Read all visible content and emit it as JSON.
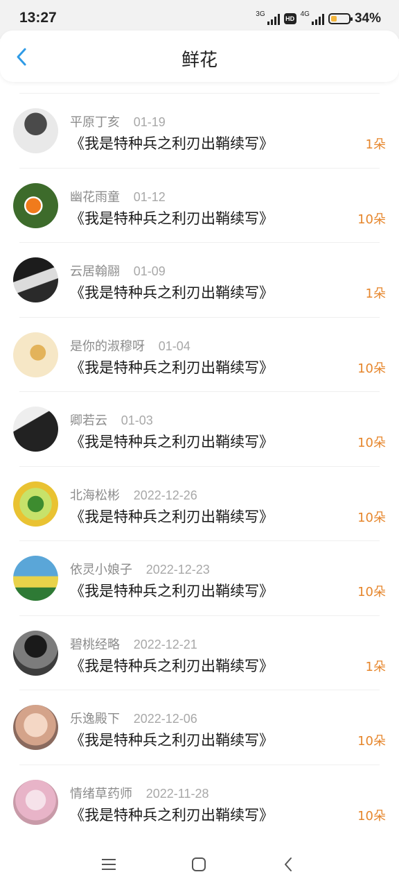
{
  "status_bar": {
    "time": "13:27",
    "net1": "3G",
    "hd": "HD",
    "net2": "4G",
    "battery_percent": "34%",
    "battery_level": 0.34
  },
  "header": {
    "title": "鲜花",
    "back_icon": "chevron-left-icon",
    "accent_color": "#2f9be6"
  },
  "colors": {
    "count": "#e6862c",
    "name": "#8c8c8c"
  },
  "items": [
    {
      "name": "平原丁亥",
      "date": "01-19",
      "book": "《我是特种兵之利刃出鞘续写》",
      "count": "1朵"
    },
    {
      "name": "幽花雨童",
      "date": "01-12",
      "book": "《我是特种兵之利刃出鞘续写》",
      "count": "10朵"
    },
    {
      "name": "云居翰翮",
      "date": "01-09",
      "book": "《我是特种兵之利刃出鞘续写》",
      "count": "1朵"
    },
    {
      "name": "是你的淑穆呀",
      "date": "01-04",
      "book": "《我是特种兵之利刃出鞘续写》",
      "count": "10朵"
    },
    {
      "name": "卿若云",
      "date": "01-03",
      "book": "《我是特种兵之利刃出鞘续写》",
      "count": "10朵"
    },
    {
      "name": "北海松彬",
      "date": "2022-12-26",
      "book": "《我是特种兵之利刃出鞘续写》",
      "count": "10朵"
    },
    {
      "name": "依灵小娘子",
      "date": "2022-12-23",
      "book": "《我是特种兵之利刃出鞘续写》",
      "count": "10朵"
    },
    {
      "name": "碧桃经略",
      "date": "2022-12-21",
      "book": "《我是特种兵之利刃出鞘续写》",
      "count": "1朵"
    },
    {
      "name": "乐逸殿下",
      "date": "2022-12-06",
      "book": "《我是特种兵之利刃出鞘续写》",
      "count": "10朵"
    },
    {
      "name": "情绪草药师",
      "date": "2022-11-28",
      "book": "《我是特种兵之利刃出鞘续写》",
      "count": "10朵"
    }
  ],
  "system_nav": {
    "menu_icon": "menu-icon",
    "home_icon": "home-icon",
    "back_icon": "back-icon"
  }
}
